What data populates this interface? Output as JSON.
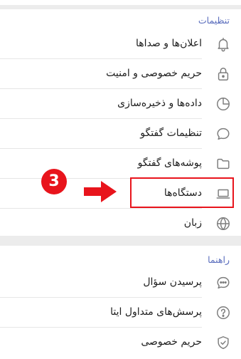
{
  "settings": {
    "title": "تنظیمات",
    "items": [
      {
        "label": "اعلان‌ها و صداها",
        "icon": "bell-icon"
      },
      {
        "label": "حریم خصوصی و امنیت",
        "icon": "lock-icon"
      },
      {
        "label": "داده‌ها و ذخیره‌سازی",
        "icon": "pie-chart-icon"
      },
      {
        "label": "تنظیمات گفتگو",
        "icon": "chat-bubble-icon"
      },
      {
        "label": "پوشه‌های گفتگو",
        "icon": "folder-icon"
      },
      {
        "label": "دستگاه‌ها",
        "icon": "laptop-icon"
      },
      {
        "label": "زبان",
        "icon": "globe-icon"
      }
    ]
  },
  "help": {
    "title": "راهنما",
    "items": [
      {
        "label": "پرسیدن سؤال",
        "icon": "chat-dots-icon"
      },
      {
        "label": "پرسش‌های متداول ایتا",
        "icon": "question-circle-icon"
      },
      {
        "label": "حریم خصوصی",
        "icon": "shield-check-icon"
      }
    ]
  },
  "annotation": {
    "step_number": "3",
    "highlight_color": "#e8141c"
  },
  "colors": {
    "section_title": "#5a6dbd",
    "text": "#1d1d1d",
    "icon": "#7d7d7d",
    "background": "#ececec"
  }
}
